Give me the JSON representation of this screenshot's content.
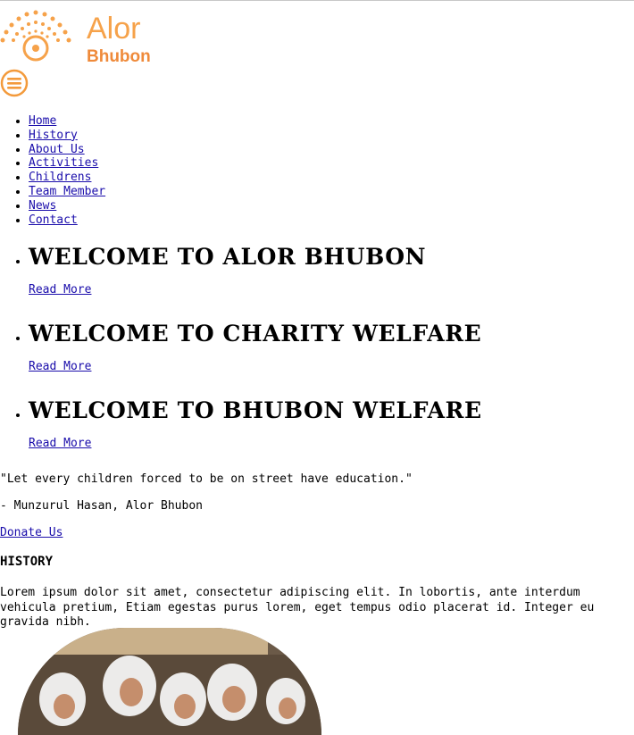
{
  "logo": {
    "title": "Alor",
    "subtitle": "Bhubon"
  },
  "menu_button": {
    "icon": "hamburger-menu-icon"
  },
  "nav": {
    "items": [
      {
        "label": "Home"
      },
      {
        "label": "History"
      },
      {
        "label": "About Us"
      },
      {
        "label": "Activities"
      },
      {
        "label": "Childrens"
      },
      {
        "label": "Team Member"
      },
      {
        "label": "News"
      },
      {
        "label": "Contact"
      }
    ]
  },
  "slides": [
    {
      "title": "WELCOME TO ALOR BHUBON",
      "link": "Read More"
    },
    {
      "title": "WELCOME TO CHARITY WELFARE",
      "link": "Read More"
    },
    {
      "title": "WELCOME TO BHUBON WELFARE",
      "link": "Read More"
    }
  ],
  "quote": {
    "text": "\"Let every children forced to be on street have education.\"",
    "author": "- Munzurul Hasan, Alor Bhubon"
  },
  "donate": {
    "label": "Donate Us"
  },
  "history": {
    "heading": "HISTORY",
    "text": "Lorem ipsum dolor sit amet, consectetur adipiscing elit. In lobortis, ante interdum vehicula pretium, Etiam egestas purus lorem, eget tempus odio placerat id. Integer eu gravida nibh."
  },
  "colors": {
    "brand": "#f6a24a",
    "brand_dark": "#ef8a3a",
    "link": "#1a0dab"
  }
}
